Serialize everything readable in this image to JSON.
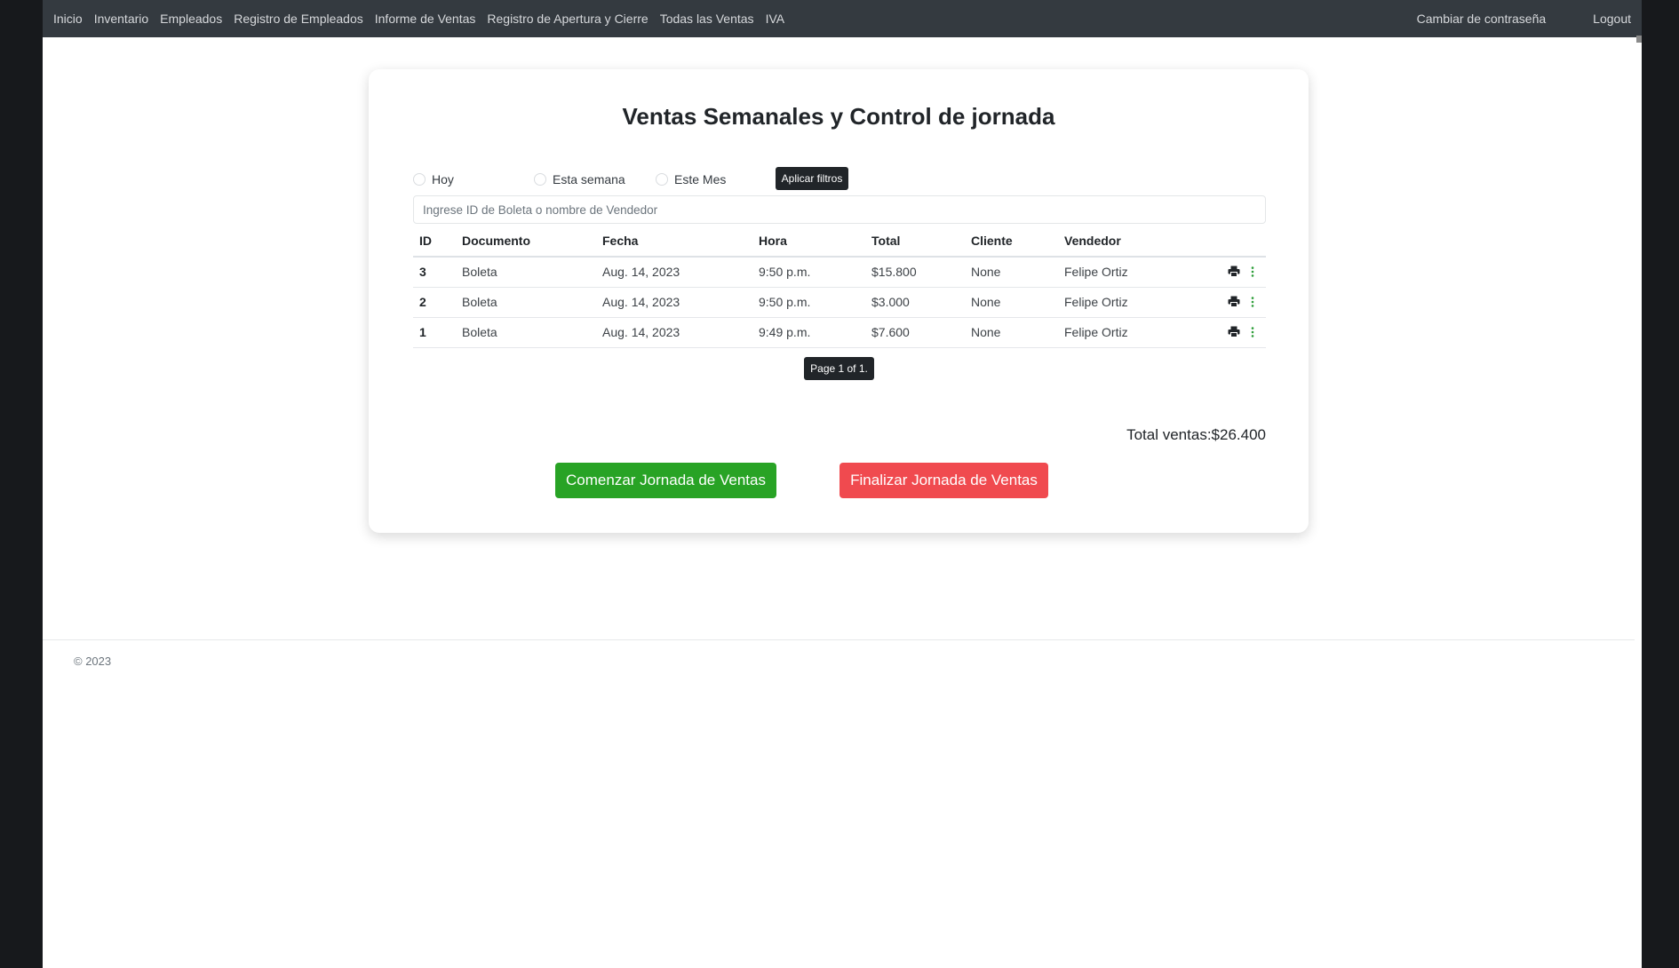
{
  "nav": {
    "left_links": [
      "Inicio",
      "Inventario",
      "Empleados",
      "Registro de Empleados",
      "Informe de Ventas",
      "Registro de Apertura y Cierre",
      "Todas las Ventas",
      "IVA"
    ],
    "change_password": "Cambiar de contraseña",
    "logout": "Logout"
  },
  "card": {
    "title": "Ventas Semanales y Control de jornada"
  },
  "filters": {
    "today": "Hoy",
    "this_week": "Esta semana",
    "this_month": "Este Mes",
    "apply_label": "Aplicar filtros"
  },
  "search": {
    "placeholder": "Ingrese ID de Boleta o nombre de Vendedor",
    "value": ""
  },
  "table": {
    "headers": {
      "id": "ID",
      "document": "Documento",
      "date": "Fecha",
      "time": "Hora",
      "total": "Total",
      "client": "Cliente",
      "seller": "Vendedor"
    },
    "rows": [
      {
        "id": "3",
        "document": "Boleta",
        "date": "Aug. 14, 2023",
        "time": "9:50 p.m.",
        "total": "$15.800",
        "client": "None",
        "seller": "Felipe Ortiz"
      },
      {
        "id": "2",
        "document": "Boleta",
        "date": "Aug. 14, 2023",
        "time": "9:50 p.m.",
        "total": "$3.000",
        "client": "None",
        "seller": "Felipe Ortiz"
      },
      {
        "id": "1",
        "document": "Boleta",
        "date": "Aug. 14, 2023",
        "time": "9:49 p.m.",
        "total": "$7.600",
        "client": "None",
        "seller": "Felipe Ortiz"
      }
    ],
    "row_icons": [
      "print-icon",
      "kebab-menu-icon"
    ]
  },
  "pagination": {
    "label": "Page 1 of 1."
  },
  "totals": {
    "label": "Total ventas:$26.400"
  },
  "actions": {
    "start_label": "Comenzar Jornada de Ventas",
    "end_label": "Finalizar Jornada de Ventas"
  },
  "footer": {
    "copyright": "© 2023"
  },
  "colors": {
    "navbar_bg": "#343a40",
    "start_button": "#28a325",
    "end_button": "#f04a4f",
    "dark_button": "#212529",
    "kebab_icon": "#2e9e3a"
  }
}
